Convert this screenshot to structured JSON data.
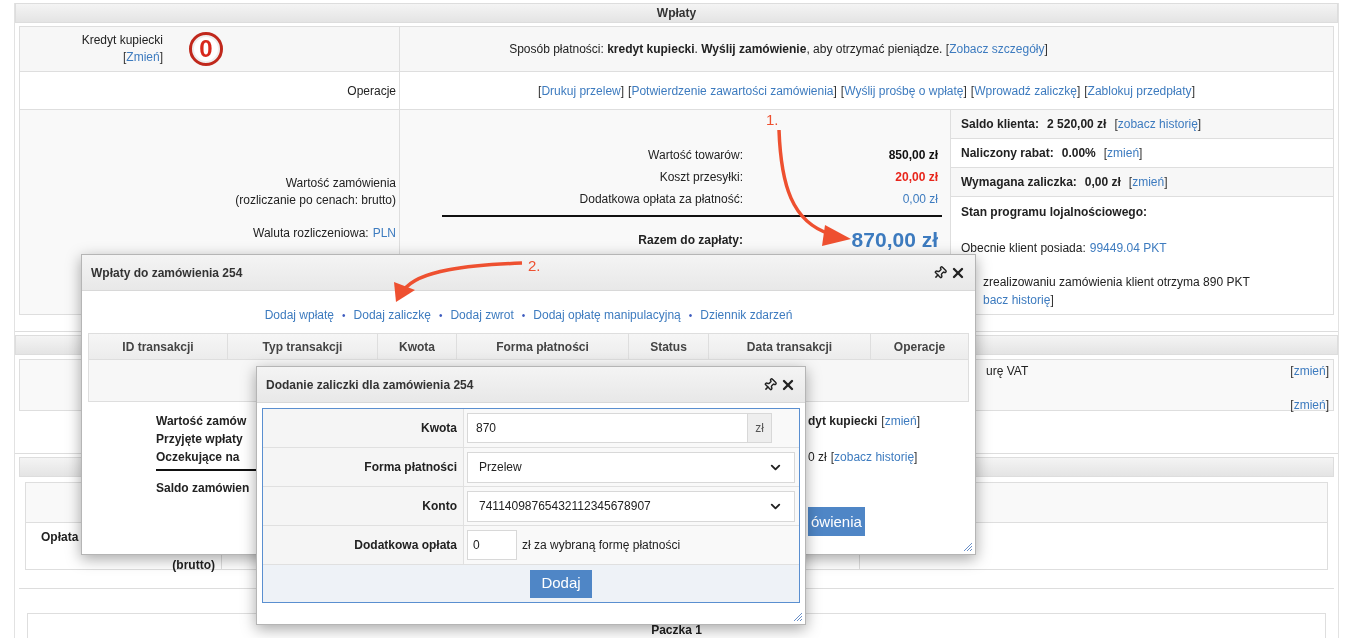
{
  "payments_section": {
    "title": "Wpłaty",
    "payment_method": {
      "label": "Kredyt kupiecki",
      "change_link": "[Zmień]",
      "badge": "0",
      "text": "Sposób płatności: **kredyt kupiecki**. **Wyślij zamówienie**, aby otrzymać pieniądze.",
      "details_link": "[Zobacz szczegóły]"
    },
    "operations": {
      "label": "Operacje",
      "links": [
        "[Drukuj przelew]",
        "[Potwierdzenie zawartości zamówienia]",
        "[Wyślij prośbę o wpłatę]",
        "[Wprowadź zaliczkę]",
        "[Zablokuj przedpłaty]"
      ]
    },
    "order_value": {
      "label": "Wartość zamówienia",
      "note": "(rozliczanie po cenach: brutto)",
      "currency_label": "Waluta rozliczeniowa:",
      "currency": "PLN"
    },
    "totals": [
      {
        "label": "Wartość towarów:",
        "value": "850,00 zł",
        "kind": "plain"
      },
      {
        "label": "Koszt przesyłki:",
        "value": "20,00 zł",
        "kind": "cost"
      },
      {
        "label": "Dodatkowa opłata za płatność:",
        "value": "0,00 zł",
        "kind": "link"
      }
    ],
    "total": {
      "label": "Razem do zapłaty:",
      "value": "870,00 zł"
    },
    "client": [
      {
        "label": "Saldo klienta:",
        "value": "2 520,00 zł",
        "link": "[zobacz historię]"
      },
      {
        "label": "Naliczony rabat:",
        "value": "0.00%",
        "link": "[zmień]"
      },
      {
        "label": "Wymagana zaliczka:",
        "value": "0,00 zł",
        "link": "[zmień]"
      }
    ],
    "loyalty": {
      "title": "Stan programu lojalnościowego:",
      "balance_label": "Obecnie klient posiada:",
      "balance": "99449.04 PKT",
      "after_text": "zrealizowaniu zamówienia klient otrzyma 890 PKT",
      "history_link": "bacz historię]"
    }
  },
  "invoice_section": {
    "text": "urę VAT",
    "links": [
      "[zmień]",
      "[zmień]"
    ]
  },
  "fees_section": {
    "label": "Opłata",
    "note": "(brutto)"
  },
  "package_section": {
    "title": "Paczka 1"
  },
  "annotations": [
    "1.",
    "2."
  ],
  "payments_dialog": {
    "title": "Wpłaty do zamówienia 254",
    "actions": [
      {
        "kind": "link",
        "text": "Dodaj wpłatę"
      },
      {
        "kind": "separator",
        "text": "•"
      },
      {
        "kind": "link",
        "text": "Dodaj zaliczkę"
      },
      {
        "kind": "separator",
        "text": "•"
      },
      {
        "kind": "link",
        "text": "Dodaj zwrot"
      },
      {
        "kind": "separator",
        "text": "•"
      },
      {
        "kind": "link",
        "text": "Dodaj opłatę manipulacyjną"
      },
      {
        "kind": "separator",
        "text": "•"
      },
      {
        "kind": "link",
        "text": "Dziennik zdarzeń"
      }
    ],
    "columns": [
      "ID transakcji",
      "Typ transakcji",
      "Kwota",
      "Forma płatności",
      "Status",
      "Data transakcji",
      "Operacje"
    ],
    "summary_labels": [
      "Wartość zamów",
      "Przyjęte wpłaty",
      "Oczekujące na",
      "Saldo zamówien"
    ],
    "payment_method": {
      "text": "dyt kupiecki",
      "link": "[zmień]"
    },
    "pending": {
      "text": "0 zł",
      "link": "[zobacz historię]"
    },
    "button": "ówienia"
  },
  "deposit_dialog": {
    "title": "Dodanie zaliczki dla zamówienia 254",
    "fields": [
      {
        "label": "Kwota",
        "kind": "input",
        "value": "870",
        "suffix": "zł"
      },
      {
        "label": "Forma płatności",
        "kind": "select",
        "value": "Przelew"
      },
      {
        "label": "Konto",
        "kind": "select",
        "value": "74114098765432112345678907"
      },
      {
        "label": "Dodatkowa opłata",
        "kind": "input_note",
        "value": "0",
        "note": "zł za wybraną formę płatności"
      }
    ],
    "submit": "Dodaj"
  }
}
